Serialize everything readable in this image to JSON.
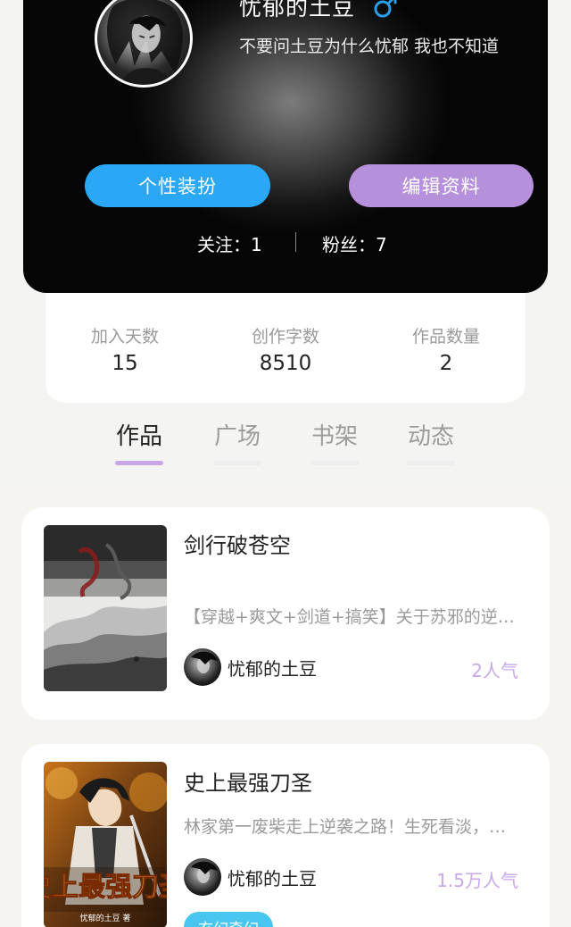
{
  "profile": {
    "username": "忧郁的土豆",
    "gender_icon": "male-symbol-icon",
    "bio": "不要问土豆为什么忧郁 我也不知道",
    "buttons": {
      "outfit": "个性装扮",
      "edit": "编辑资料"
    },
    "following": "关注：1",
    "fans": "粉丝：7"
  },
  "stats": [
    {
      "label": "加入天数",
      "value": "15"
    },
    {
      "label": "创作字数",
      "value": "8510"
    },
    {
      "label": "作品数量",
      "value": "2"
    }
  ],
  "tabs": [
    {
      "label": "作品",
      "active": true
    },
    {
      "label": "广场",
      "active": false
    },
    {
      "label": "书架",
      "active": false
    },
    {
      "label": "动态",
      "active": false
    }
  ],
  "books": [
    {
      "title": "剑行破苍空",
      "description": "【穿越+爽文+剑道+搞笑】关于苏邪的逆天之路……",
      "author": "忧郁的土豆",
      "popularity": "2人气",
      "tag": ""
    },
    {
      "title": "史上最强刀圣",
      "description": "林家第一废柴走上逆袭之路！生死看淡，不服就干……",
      "author": "忧郁的土豆",
      "popularity": "1.5万人气",
      "tag": "玄幻奇幻",
      "cover_text": "史上最强刀圣",
      "cover_author": "忧郁的土豆 著"
    }
  ],
  "colors": {
    "outfit_button": "#2aa7f5",
    "edit_button": "#b790dc",
    "popularity": "#c9a8ea",
    "active_tab_underline": "#c8a6e8",
    "tag": "#49c6ef",
    "gender_icon": "#2a9fe8"
  }
}
